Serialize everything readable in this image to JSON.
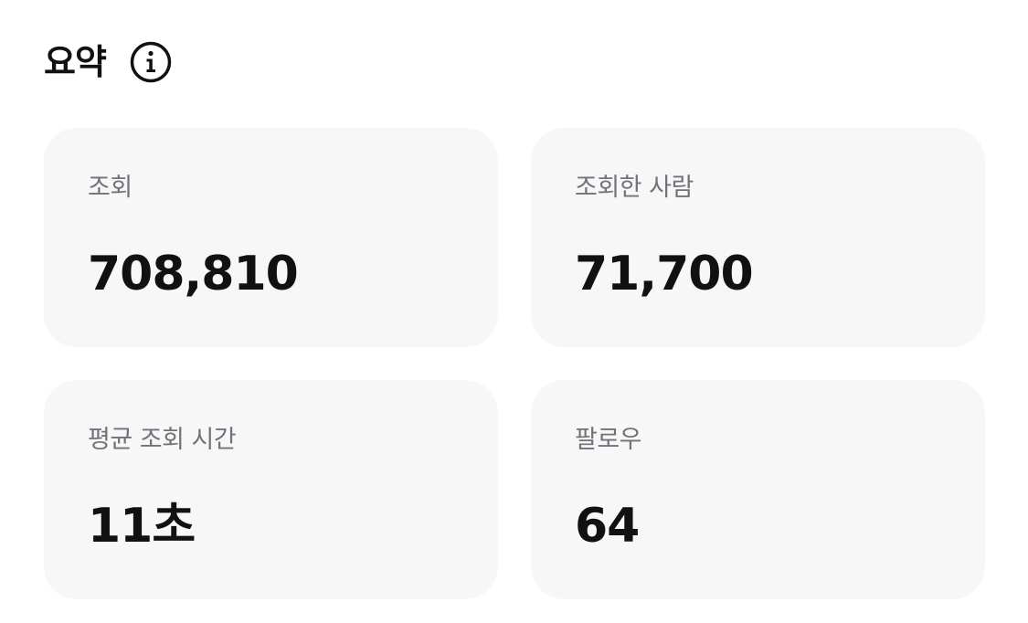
{
  "header": {
    "title": "요약",
    "info_icon": "info-circle-icon"
  },
  "summary": {
    "cards": [
      {
        "label": "조회",
        "value": "708,810"
      },
      {
        "label": "조회한 사람",
        "value": "71,700"
      },
      {
        "label": "평균 조회 시간",
        "value": "11초"
      },
      {
        "label": "팔로우",
        "value": "64"
      }
    ]
  },
  "colors": {
    "card_background": "#f7f7f7",
    "label_text": "#71737a",
    "value_text": "#111111"
  }
}
